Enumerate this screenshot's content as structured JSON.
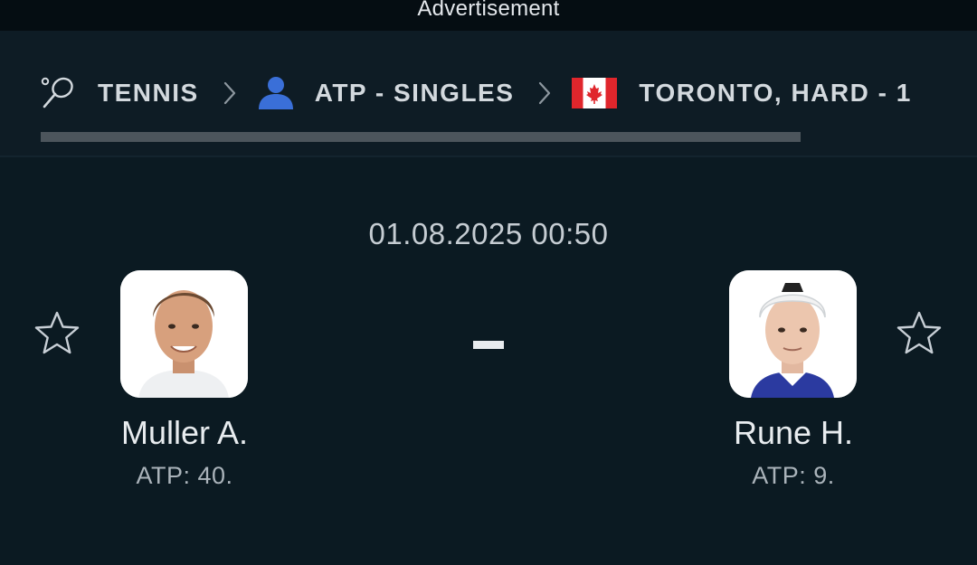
{
  "ad": {
    "label": "Advertisement"
  },
  "breadcrumb": {
    "items": [
      {
        "label": "TENNIS",
        "icon": "tennis-racket-icon"
      },
      {
        "label": "ATP - SINGLES",
        "icon": "person-icon"
      },
      {
        "label": "TORONTO, HARD - 1",
        "icon": "canada-flag-icon"
      }
    ],
    "separator_icon": "chevron-right-icon"
  },
  "match": {
    "datetime": "01.08.2025 00:50",
    "score_separator": "-",
    "home": {
      "name": "Muller A.",
      "rank": "ATP: 40.",
      "favorite_icon": "star-outline-icon"
    },
    "away": {
      "name": "Rune H.",
      "rank": "ATP: 9.",
      "favorite_icon": "star-outline-icon"
    }
  },
  "colors": {
    "background": "#0b1a22",
    "header_background": "#0e1c25",
    "ad_background": "#050d12",
    "text_primary": "#e8ecef",
    "text_secondary": "#aab3ba",
    "icon_blue": "#3a6fd8",
    "flag_red": "#e0262c"
  }
}
